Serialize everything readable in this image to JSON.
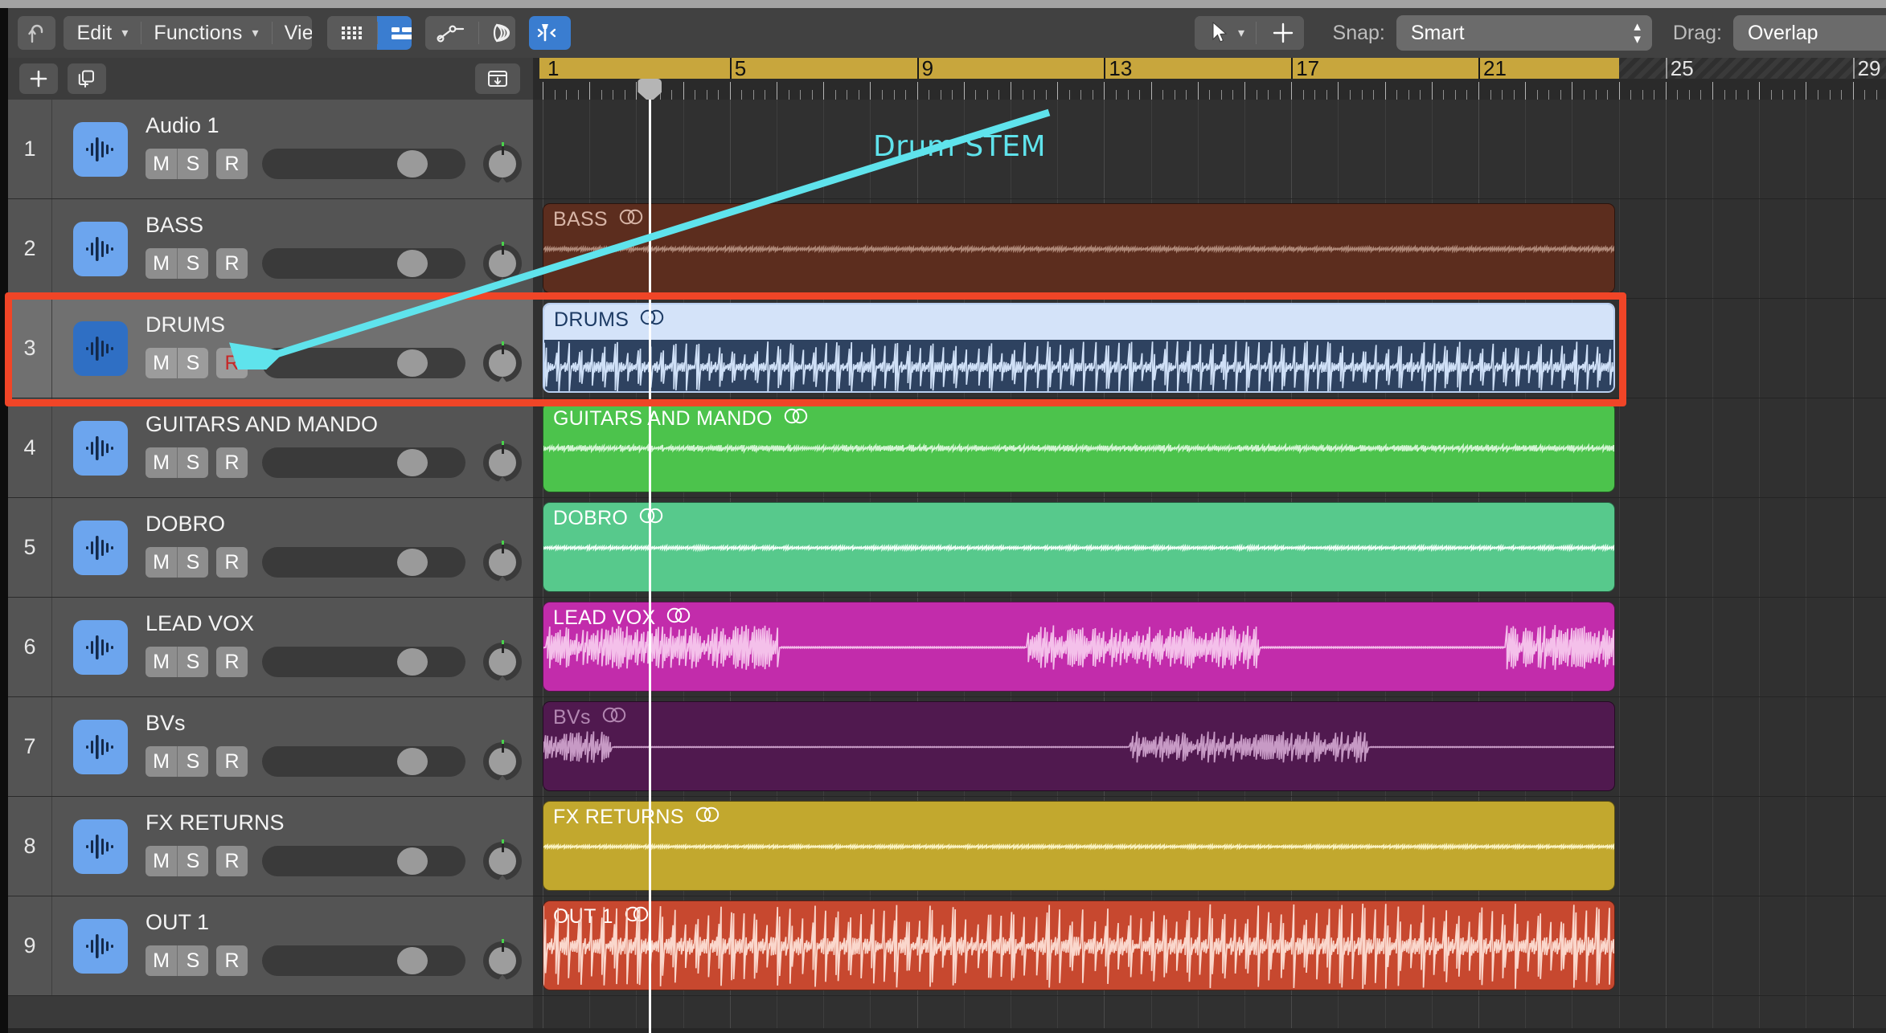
{
  "toolbar": {
    "back_button": "back-arrow",
    "menus": [
      {
        "label": "Edit"
      },
      {
        "label": "Functions"
      },
      {
        "label": "View"
      }
    ],
    "view_toggles": [
      {
        "name": "library-grid",
        "active": false
      },
      {
        "name": "list-view",
        "active": true
      }
    ],
    "edit_toggles": [
      {
        "name": "automation",
        "active": false
      },
      {
        "name": "flex-bend",
        "active": false
      }
    ],
    "flex_button": {
      "name": "flex-time",
      "active": true
    },
    "tools": [
      {
        "name": "pointer-tool"
      },
      {
        "name": "marquee-tool"
      }
    ],
    "snap": {
      "label": "Snap:",
      "value": "Smart"
    },
    "drag": {
      "label": "Drag:",
      "value": "Overlap"
    }
  },
  "track_header_toolbar": {
    "add_track": "+",
    "duplicate_track": "duplicate-track-icon",
    "hide_tracks": "hide-tracks-icon"
  },
  "ruler": {
    "bar_labels": [
      "1",
      "5",
      "9",
      "13",
      "17",
      "21",
      "25",
      "29"
    ],
    "cycle_start_bar": 1,
    "cycle_end_bar": 24,
    "playhead_bar": 3
  },
  "tracks": [
    {
      "num": "1",
      "name": "Audio 1",
      "mute": "M",
      "solo": "S",
      "rec": "R",
      "armed": false,
      "selected": false
    },
    {
      "num": "2",
      "name": "BASS",
      "mute": "M",
      "solo": "S",
      "rec": "R",
      "armed": false,
      "selected": false
    },
    {
      "num": "3",
      "name": "DRUMS",
      "mute": "M",
      "solo": "S",
      "rec": "R",
      "armed": true,
      "selected": true
    },
    {
      "num": "4",
      "name": "GUITARS AND MANDO",
      "mute": "M",
      "solo": "S",
      "rec": "R",
      "armed": false,
      "selected": false
    },
    {
      "num": "5",
      "name": "DOBRO",
      "mute": "M",
      "solo": "S",
      "rec": "R",
      "armed": false,
      "selected": false
    },
    {
      "num": "6",
      "name": "LEAD VOX",
      "mute": "M",
      "solo": "S",
      "rec": "R",
      "armed": false,
      "selected": false
    },
    {
      "num": "7",
      "name": "BVs",
      "mute": "M",
      "solo": "S",
      "rec": "R",
      "armed": false,
      "selected": false
    },
    {
      "num": "8",
      "name": "FX RETURNS",
      "mute": "M",
      "solo": "S",
      "rec": "R",
      "armed": false,
      "selected": false
    },
    {
      "num": "9",
      "name": "OUT 1",
      "mute": "M",
      "solo": "S",
      "rec": "R",
      "armed": false,
      "selected": false
    }
  ],
  "regions": [
    {
      "track": 1,
      "name": "",
      "visible": false,
      "color": "#303030",
      "title_color": "#ffffff",
      "wave_color": "#ffffff",
      "selected": false,
      "wave_density": 0
    },
    {
      "track": 2,
      "name": "BASS",
      "visible": true,
      "color": "#5c2d1e",
      "title_color": "#d7b4a6",
      "wave_color": "#b08a7a",
      "selected": false,
      "wave_density": 0.12
    },
    {
      "track": 3,
      "name": "DRUMS",
      "visible": true,
      "color": "#2e4260",
      "title_color": "#1c3a63",
      "wave_color": "#cfe0f7",
      "selected": true,
      "wave_density": 1.0
    },
    {
      "track": 4,
      "name": "GUITARS AND MANDO",
      "visible": true,
      "color": "#4cc34c",
      "title_color": "#ffffff",
      "wave_color": "#d4f5d4",
      "selected": false,
      "wave_density": 0.2
    },
    {
      "track": 5,
      "name": "DOBRO",
      "visible": true,
      "color": "#57c98c",
      "title_color": "#ffffff",
      "wave_color": "#f0fff6",
      "selected": false,
      "wave_density": 0.1
    },
    {
      "track": 6,
      "name": "LEAD VOX",
      "visible": true,
      "color": "#c22cab",
      "title_color": "#ffffff",
      "wave_color": "#f4c0ea",
      "selected": false,
      "wave_density": 0.5
    },
    {
      "track": 7,
      "name": "BVs",
      "visible": true,
      "color": "#50194f",
      "title_color": "#b287b1",
      "wave_color": "#c79ac5",
      "selected": false,
      "wave_density": 0.3
    },
    {
      "track": 8,
      "name": "FX RETURNS",
      "visible": true,
      "color": "#c2a82e",
      "title_color": "#ffffff",
      "wave_color": "#fbf4c4",
      "selected": false,
      "wave_density": 0.08
    },
    {
      "track": 9,
      "name": "OUT 1",
      "visible": true,
      "color": "#c7482f",
      "title_color": "#ffffff",
      "wave_color": "#fad7cc",
      "selected": false,
      "wave_density": 0.95
    }
  ],
  "annotations": {
    "callout_text": "Drum STEM",
    "callout_color": "#5fe3ec",
    "highlight_color": "#f04527",
    "highlight_target_track": "DRUMS"
  },
  "colors": {
    "accent_blue": "#3a7dd0",
    "toolbar_bg": "#414141",
    "header_bg": "#545454",
    "header_selected_bg": "#707070",
    "arrange_bg": "#303030",
    "cycle_gold": "#c8a63d",
    "record_red": "#c62828"
  }
}
